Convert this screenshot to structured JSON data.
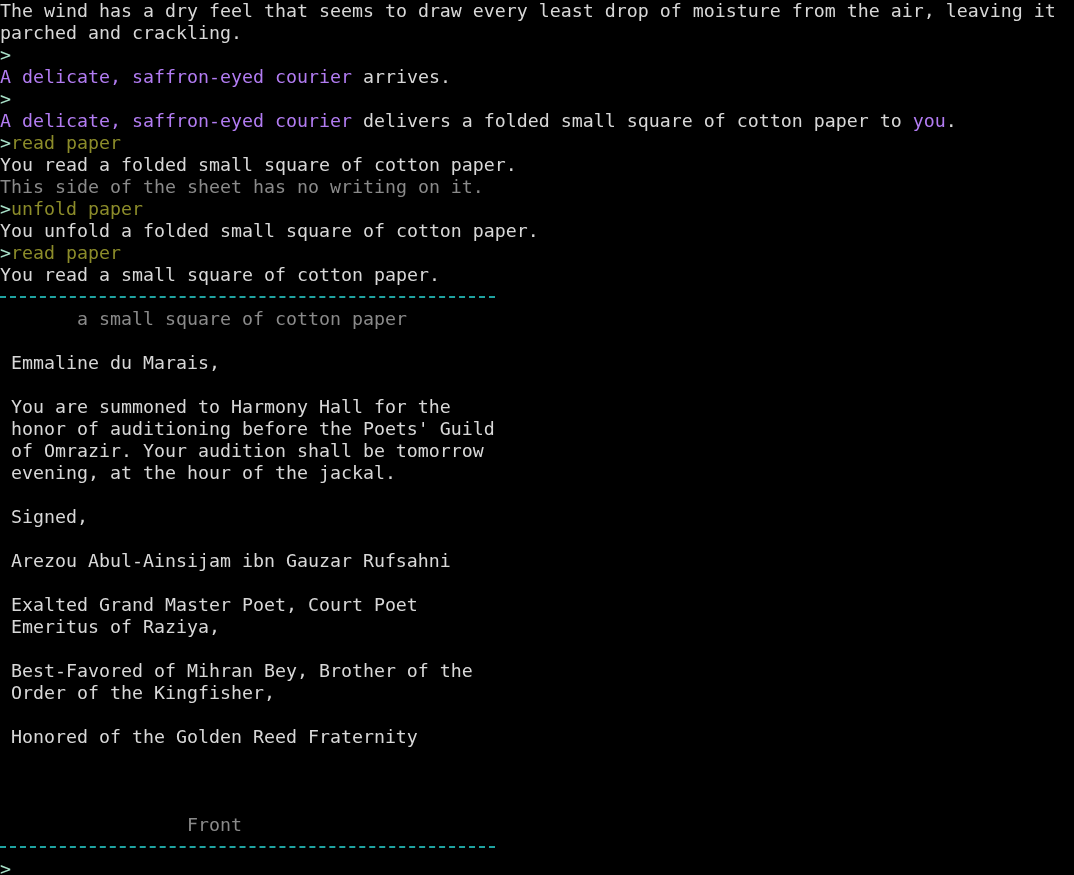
{
  "log": [
    {
      "segments": [
        {
          "kind": "plain",
          "text": "The wind has a dry feel that seems to draw every least drop of moisture from the air, leaving it parched and crackling."
        }
      ]
    },
    {
      "segments": [
        {
          "kind": "prompt",
          "text": ">"
        }
      ]
    },
    {
      "segments": [
        {
          "kind": "name",
          "text": "A delicate, saffron-eyed courier"
        },
        {
          "kind": "plain",
          "text": " arrives."
        }
      ]
    },
    {
      "segments": [
        {
          "kind": "prompt",
          "text": ">"
        }
      ]
    },
    {
      "segments": [
        {
          "kind": "name",
          "text": "A delicate, saffron-eyed courier"
        },
        {
          "kind": "plain",
          "text": " delivers a folded small square of cotton paper to "
        },
        {
          "kind": "name",
          "text": "you"
        },
        {
          "kind": "plain",
          "text": "."
        }
      ]
    },
    {
      "segments": [
        {
          "kind": "prompt",
          "text": ">"
        },
        {
          "kind": "command",
          "text": "read paper"
        }
      ]
    },
    {
      "segments": [
        {
          "kind": "plain",
          "text": "You read a folded small square of cotton paper."
        }
      ]
    },
    {
      "segments": [
        {
          "kind": "dim",
          "text": "This side of the sheet has no writing on it."
        }
      ]
    },
    {
      "segments": [
        {
          "kind": "prompt",
          "text": ">"
        },
        {
          "kind": "command",
          "text": "unfold paper"
        }
      ]
    },
    {
      "segments": [
        {
          "kind": "plain",
          "text": "You unfold a folded small square of cotton paper."
        }
      ]
    },
    {
      "segments": [
        {
          "kind": "prompt",
          "text": ">"
        },
        {
          "kind": "command",
          "text": "read paper"
        }
      ]
    },
    {
      "segments": [
        {
          "kind": "plain",
          "text": "You read a small square of cotton paper."
        }
      ]
    }
  ],
  "paper": {
    "title": "a small square of cotton paper",
    "paragraphs": [
      [
        "Emmaline du Marais,"
      ],
      [
        "You are summoned to Harmony Hall for the",
        "honor of auditioning before the Poets' Guild",
        "of Omrazir. Your audition shall be tomorrow",
        "evening, at the hour of the jackal."
      ],
      [
        "Signed,"
      ],
      [
        "Arezou Abul-Ainsijam ibn Gauzar Rufsahni"
      ],
      [
        "Exalted Grand Master Poet, Court Poet",
        "Emeritus of Raziya,"
      ],
      [
        "Best-Favored of Mihran Bey, Brother of the",
        "Order of the Kingfisher,"
      ],
      [
        "Honored of the Golden Reed Fraternity"
      ]
    ],
    "footer": "Front"
  },
  "prompt": ">"
}
